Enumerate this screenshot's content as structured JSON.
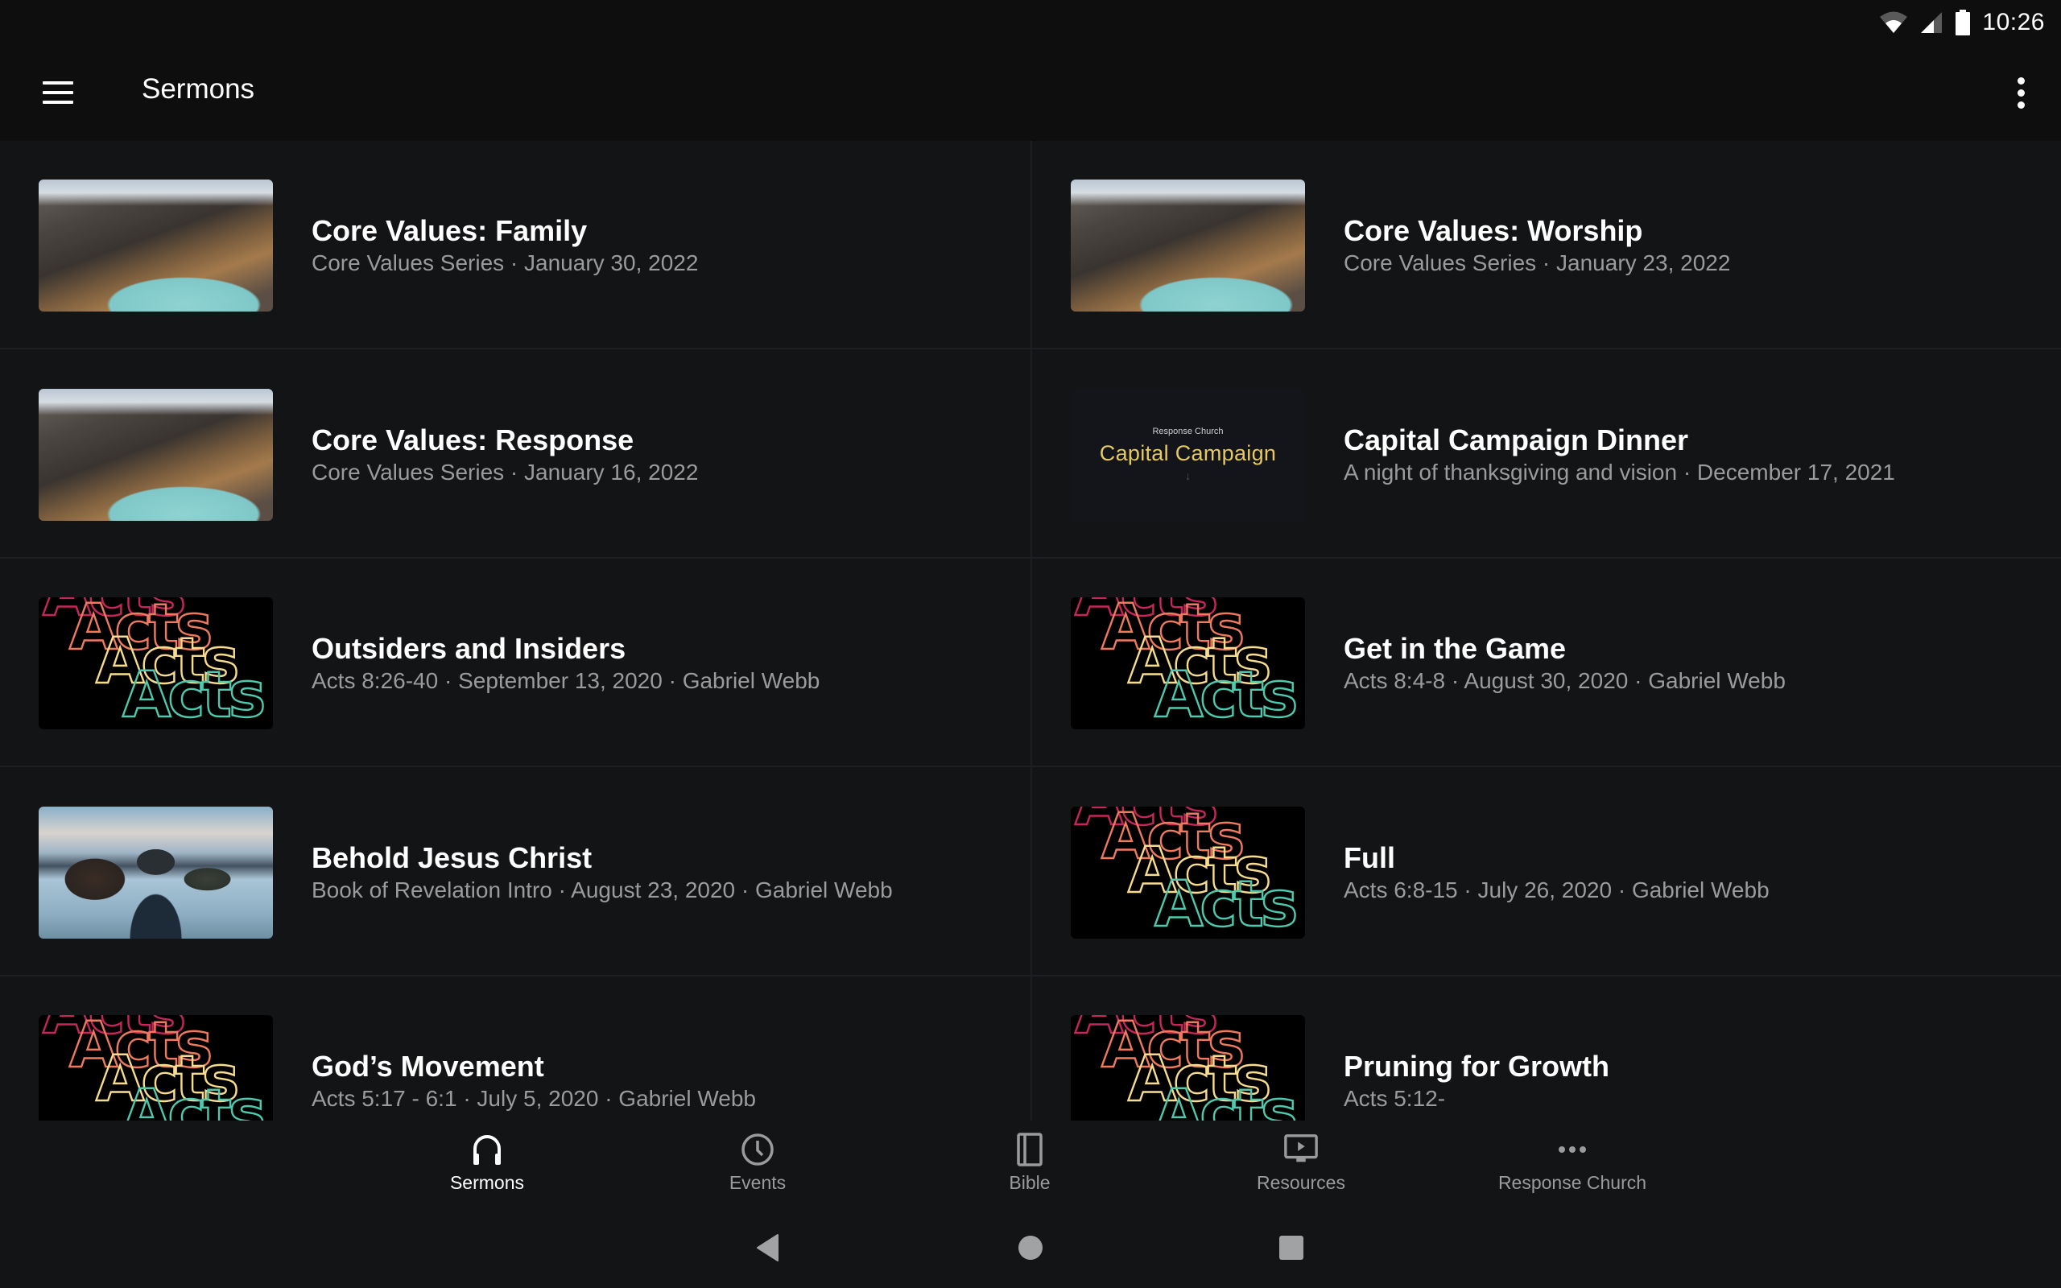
{
  "status_bar": {
    "time": "10:26",
    "icons": [
      "wifi-icon",
      "cellular-signal-icon",
      "battery-icon"
    ]
  },
  "app_bar": {
    "title": "Sermons",
    "menu_icon": "hamburger-menu-icon",
    "overflow_icon": "more-vertical-icon"
  },
  "sermons": [
    {
      "title": "Core Values: Family",
      "subtitle": "Core Values Series · January 30, 2022",
      "thumbnail": "mountain-crater-lake"
    },
    {
      "title": "Core Values: Worship",
      "subtitle": "Core Values Series · January 23, 2022",
      "thumbnail": "mountain-crater-lake"
    },
    {
      "title": "Core Values: Response",
      "subtitle": "Core Values Series · January 16, 2022",
      "thumbnail": "mountain-crater-lake"
    },
    {
      "title": "Capital Campaign Dinner",
      "subtitle": "A night of thanksgiving and vision · December 17, 2021",
      "thumbnail": "capital-campaign",
      "thumb_text": {
        "small": "Response Church",
        "big": "Capital Campaign",
        "arrow": "↓"
      }
    },
    {
      "title": "Outsiders and Insiders",
      "subtitle": "Acts 8:26-40 · September 13, 2020 · Gabriel Webb",
      "thumbnail": "acts-series"
    },
    {
      "title": "Get in the Game",
      "subtitle": "Acts 8:4-8 · August 30, 2020 · Gabriel Webb",
      "thumbnail": "acts-series"
    },
    {
      "title": "Behold Jesus Christ",
      "subtitle": "Book of Revelation Intro · August 23, 2020 · Gabriel Webb",
      "thumbnail": "man-at-lake"
    },
    {
      "title": "Full",
      "subtitle": "Acts 6:8-15 · July 26, 2020 · Gabriel Webb",
      "thumbnail": "acts-series"
    },
    {
      "title": "God’s Movement",
      "subtitle": "Acts 5:17 - 6:1 · July 5, 2020 · Gabriel Webb",
      "thumbnail": "acts-series"
    },
    {
      "title": "Pruning for Growth",
      "subtitle": "Acts 5:12-",
      "thumbnail": "acts-series"
    }
  ],
  "acts_thumb_word": "Acts",
  "bottom_nav": [
    {
      "label": "Sermons",
      "icon": "headphones-icon",
      "active": true
    },
    {
      "label": "Events",
      "icon": "clock-icon",
      "active": false
    },
    {
      "label": "Bible",
      "icon": "book-icon",
      "active": false
    },
    {
      "label": "Resources",
      "icon": "video-play-icon",
      "active": false
    },
    {
      "label": "Response Church",
      "icon": "more-horizontal-icon",
      "active": false
    }
  ],
  "system_nav": [
    "back-icon",
    "home-icon",
    "recents-icon"
  ],
  "colors": {
    "background": "#131416",
    "bar": "#0e0e0e",
    "text_primary": "#ffffff",
    "text_secondary": "#9a9b9d",
    "divider": "#1e1f22",
    "campaign_gold": "#e6c960"
  }
}
